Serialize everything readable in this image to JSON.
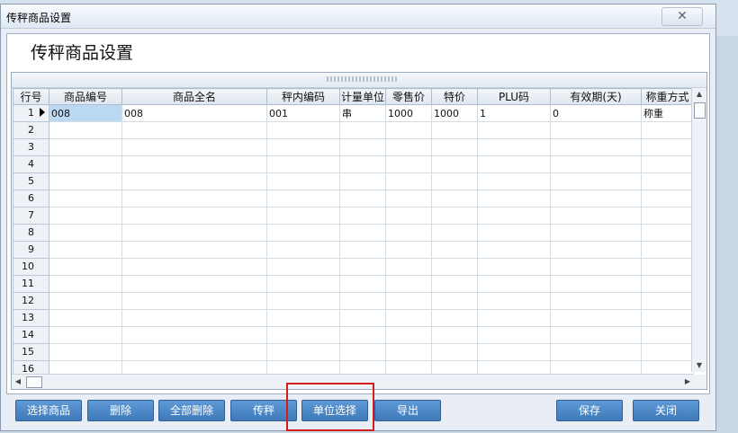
{
  "window": {
    "title": "传秤商品设置",
    "close_glyph": "✕"
  },
  "heading": "传秤商品设置",
  "grid": {
    "columns": [
      "行号",
      "商品编号",
      "商品全名",
      "秤内编码",
      "计量单位",
      "零售价",
      "特价",
      "PLU码",
      "有效期(天)",
      "称重方式"
    ],
    "rows": [
      {
        "n": "1",
        "cells": [
          "008",
          "008",
          "001",
          "串",
          "1000",
          "1000",
          "1",
          "0",
          "称重"
        ]
      },
      {
        "n": "2",
        "cells": [
          "",
          "",
          "",
          "",
          "",
          "",
          "",
          "",
          ""
        ]
      },
      {
        "n": "3",
        "cells": [
          "",
          "",
          "",
          "",
          "",
          "",
          "",
          "",
          ""
        ]
      },
      {
        "n": "4",
        "cells": [
          "",
          "",
          "",
          "",
          "",
          "",
          "",
          "",
          ""
        ]
      },
      {
        "n": "5",
        "cells": [
          "",
          "",
          "",
          "",
          "",
          "",
          "",
          "",
          ""
        ]
      },
      {
        "n": "6",
        "cells": [
          "",
          "",
          "",
          "",
          "",
          "",
          "",
          "",
          ""
        ]
      },
      {
        "n": "7",
        "cells": [
          "",
          "",
          "",
          "",
          "",
          "",
          "",
          "",
          ""
        ]
      },
      {
        "n": "8",
        "cells": [
          "",
          "",
          "",
          "",
          "",
          "",
          "",
          "",
          ""
        ]
      },
      {
        "n": "9",
        "cells": [
          "",
          "",
          "",
          "",
          "",
          "",
          "",
          "",
          ""
        ]
      },
      {
        "n": "10",
        "cells": [
          "",
          "",
          "",
          "",
          "",
          "",
          "",
          "",
          ""
        ]
      },
      {
        "n": "11",
        "cells": [
          "",
          "",
          "",
          "",
          "",
          "",
          "",
          "",
          ""
        ]
      },
      {
        "n": "12",
        "cells": [
          "",
          "",
          "",
          "",
          "",
          "",
          "",
          "",
          ""
        ]
      },
      {
        "n": "13",
        "cells": [
          "",
          "",
          "",
          "",
          "",
          "",
          "",
          "",
          ""
        ]
      },
      {
        "n": "14",
        "cells": [
          "",
          "",
          "",
          "",
          "",
          "",
          "",
          "",
          ""
        ]
      },
      {
        "n": "15",
        "cells": [
          "",
          "",
          "",
          "",
          "",
          "",
          "",
          "",
          ""
        ]
      },
      {
        "n": "16",
        "cells": [
          "",
          "",
          "",
          "",
          "",
          "",
          "",
          "",
          ""
        ]
      }
    ]
  },
  "buttons": {
    "select_goods": "选择商品",
    "delete": "删除",
    "delete_all": "全部删除",
    "transfer": "传秤",
    "unit_select": "单位选择",
    "export": "导出",
    "save": "保存",
    "close": "关闭"
  },
  "colors": {
    "button": "#4a86c6",
    "highlight": "#d21d1d",
    "selected_cell": "#bcd9f3"
  }
}
